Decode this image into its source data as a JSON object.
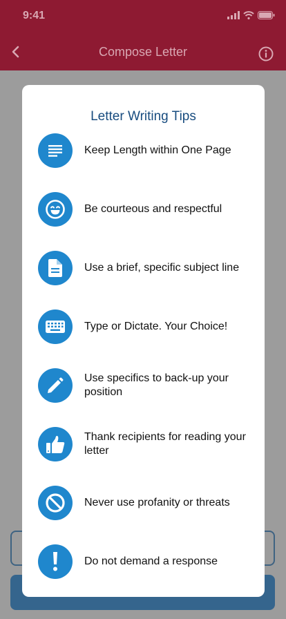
{
  "status": {
    "time": "9:41"
  },
  "nav": {
    "title": "Compose Letter"
  },
  "modal": {
    "title": "Letter Writing Tips",
    "tips": [
      {
        "icon": "lines-icon",
        "text": "Keep Length within One Page"
      },
      {
        "icon": "smiley-icon",
        "text": "Be courteous and respectful"
      },
      {
        "icon": "document-icon",
        "text": "Use a brief, specific subject line"
      },
      {
        "icon": "keyboard-icon",
        "text": "Type or Dictate. Your Choice!"
      },
      {
        "icon": "pencil-icon",
        "text": "Use specifics to back-up your position"
      },
      {
        "icon": "thumbs-up-icon",
        "text": "Thank recipients for reading your letter"
      },
      {
        "icon": "prohibited-icon",
        "text": "Never use profanity or threats"
      },
      {
        "icon": "exclamation-icon",
        "text": "Do not demand a response"
      }
    ]
  },
  "colors": {
    "header": "#8e1a32",
    "accent": "#1f87cd",
    "title": "#184c7f"
  }
}
